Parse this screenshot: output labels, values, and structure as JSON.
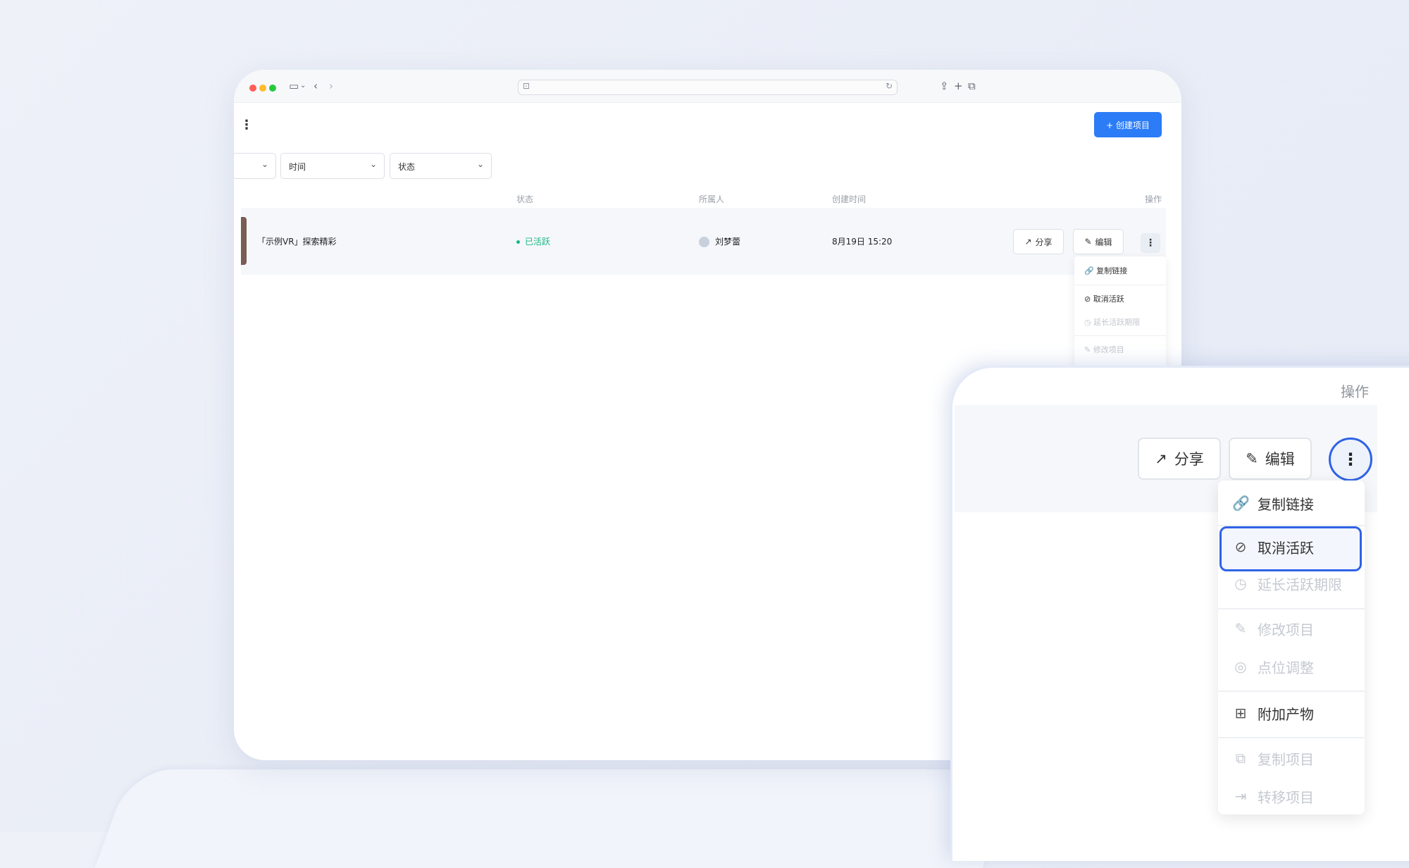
{
  "create_button": {
    "icon": "plus-icon",
    "label": "+ 创建项目"
  },
  "filters": [
    {
      "label": ""
    },
    {
      "label": "时间"
    },
    {
      "label": "状态"
    }
  ],
  "table": {
    "headers": {
      "status": "状态",
      "owner": "所属人",
      "created": "创建时间",
      "actions": "操作"
    },
    "row": {
      "name": "「示例VR」探索精彩",
      "status": "已活跃",
      "owner": "刘梦蕾",
      "created": "8月19日 15:20"
    }
  },
  "row_actions": {
    "share": "分享",
    "edit": "编辑"
  },
  "menu_small": [
    {
      "label": "复制链接",
      "icon": "link-icon",
      "disabled": false
    },
    {
      "label": "取消活跃",
      "icon": "ban-icon",
      "disabled": false
    },
    {
      "label": "延长活跃期限",
      "icon": "clock-icon",
      "disabled": true
    },
    {
      "label": "修改项目",
      "icon": "edit-icon",
      "disabled": true
    }
  ],
  "zoom": {
    "header": "操作",
    "share": "分享",
    "edit": "编辑",
    "menu": [
      {
        "label": "复制链接",
        "icon": "link-icon",
        "disabled": false
      },
      {
        "label": "取消活跃",
        "icon": "ban-icon",
        "disabled": false,
        "highlighted": true
      },
      {
        "label": "延长活跃期限",
        "icon": "clock-icon",
        "disabled": true
      },
      {
        "label": "修改项目",
        "icon": "edit-icon",
        "disabled": true
      },
      {
        "label": "点位调整",
        "icon": "target-icon",
        "disabled": true
      },
      {
        "label": "附加产物",
        "icon": "grid-icon",
        "disabled": false
      },
      {
        "label": "复制项目",
        "icon": "copy-icon",
        "disabled": true
      },
      {
        "label": "转移项目",
        "icon": "transfer-icon",
        "disabled": true
      }
    ]
  },
  "colors": {
    "accent": "#2b7cf6",
    "active": "#19b97f",
    "highlight": "#2f63e6"
  }
}
